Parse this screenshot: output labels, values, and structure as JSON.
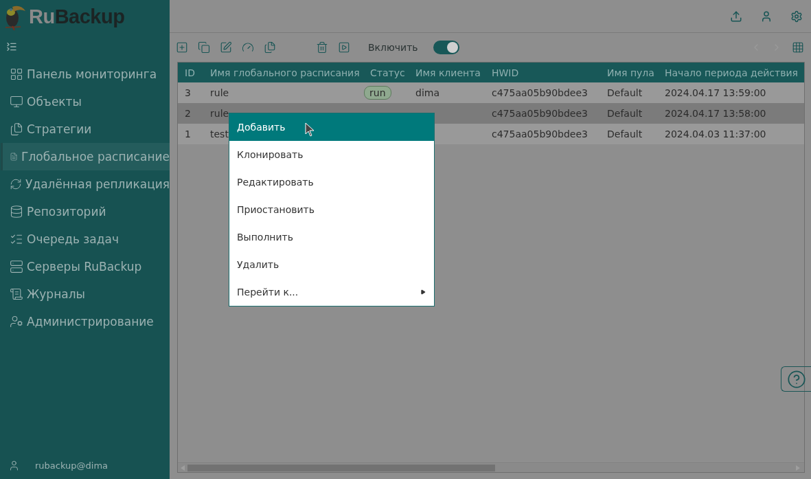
{
  "logo": {
    "part_1": "Ru",
    "part_2": "Backup"
  },
  "sidebar": {
    "items": [
      {
        "label": "Панель мониторинга",
        "selected": false
      },
      {
        "label": "Объекты",
        "selected": false
      },
      {
        "label": "Стратегии",
        "selected": false
      },
      {
        "label": "Глобальное расписание",
        "selected": true
      },
      {
        "label": "Удалённая репликация",
        "selected": false
      },
      {
        "label": "Репозиторий",
        "selected": false
      },
      {
        "label": "Очередь задач",
        "selected": false
      },
      {
        "label": "Серверы RuBackup",
        "selected": false
      },
      {
        "label": "Журналы",
        "selected": false
      },
      {
        "label": "Администрирование",
        "selected": false
      }
    ],
    "user": "rubackup@dima"
  },
  "toolbar": {
    "toggle": {
      "label": "Включить",
      "on": true
    }
  },
  "table": {
    "columns": [
      "ID",
      "Имя глобального расписания",
      "Статус",
      "Имя клиента",
      "HWID",
      "Имя пула",
      "Начало периода действия"
    ],
    "rows": [
      {
        "selected": false,
        "cells": [
          "3",
          "rule",
          "run",
          "dima",
          "c475aa05b90bdee3",
          "Default",
          "2024.04.17 13:59:00"
        ]
      },
      {
        "selected": true,
        "cells": [
          "2",
          "rule",
          null,
          null,
          "c475aa05b90bdee3",
          "Default",
          "2024.04.17 13:58:00"
        ]
      },
      {
        "selected": false,
        "cells": [
          "1",
          "test",
          null,
          null,
          "c475aa05b90bdee3",
          "Default",
          "2024.04.03 11:37:00"
        ]
      }
    ]
  },
  "context_menu": {
    "items": [
      {
        "label": "Добавить",
        "selected": true,
        "submenu": false
      },
      {
        "label": "Клонировать",
        "selected": false,
        "submenu": false
      },
      {
        "label": "Редактировать",
        "selected": false,
        "submenu": false
      },
      {
        "label": "Приостановить",
        "selected": false,
        "submenu": false
      },
      {
        "label": "Выполнить",
        "selected": false,
        "submenu": false
      },
      {
        "label": "Удалить",
        "selected": false,
        "submenu": false
      },
      {
        "label": "Перейти к...",
        "selected": false,
        "submenu": true
      }
    ]
  }
}
